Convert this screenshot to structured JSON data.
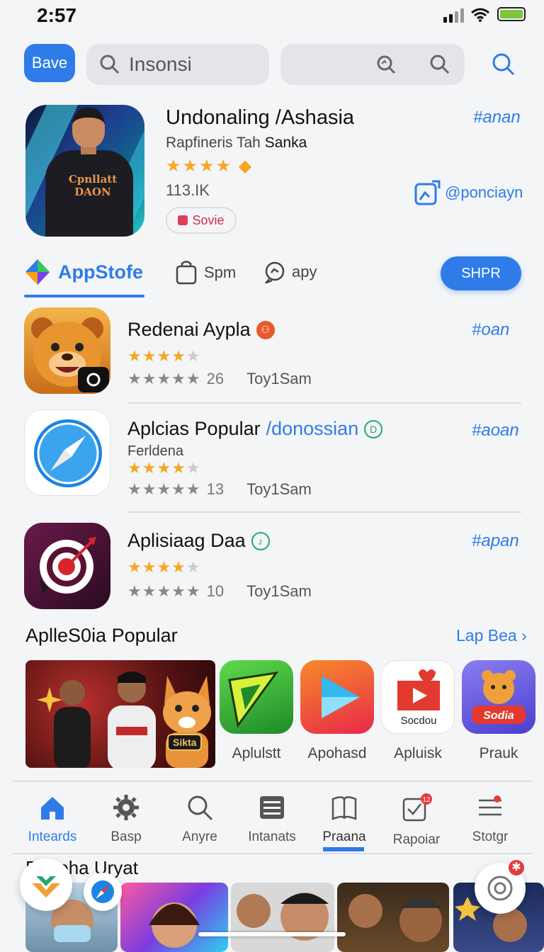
{
  "status": {
    "time": "2:57"
  },
  "header": {
    "save_label": "Bave",
    "search_text": "Insonsi"
  },
  "featured": {
    "title": "Undonaling /Ashasia",
    "subtitle_a": "Rapfineris Tah",
    "subtitle_b": "Sanka",
    "stars": "★★★★",
    "count": "113.IK",
    "badge": "Sovie",
    "tag": "#anan",
    "link": "@ponciayn",
    "shirt_text": "Cpnllatt DAON"
  },
  "tabs": {
    "store": "AppStofe",
    "tab2": "Spm",
    "tab3": "apy",
    "button": "SHPR"
  },
  "apps": [
    {
      "name": "Redenai Aypla",
      "tag": "#oan",
      "count": "26",
      "publisher": "Toy1Sam"
    },
    {
      "name": "Aplcias Popular",
      "name_suffix": "/donossian",
      "developer": "Ferldena",
      "tag": "#aoan",
      "count": "13",
      "publisher": "Toy1Sam"
    },
    {
      "name": "Aplisiaag Daa",
      "tag": "#apan",
      "count": "10",
      "publisher": "Toy1Sam"
    }
  ],
  "stars_glyph": "★★★★",
  "grey_stars": "★★★★★",
  "popular": {
    "title": "AplleS0ia Popular",
    "more": "Lap Bea ›",
    "banner_tag": "Sikta",
    "apps": [
      {
        "label": "Aplulstt"
      },
      {
        "label": "Apohasd"
      },
      {
        "label": "Apluisk",
        "icon_text": "Socdou"
      },
      {
        "label": "Prauk",
        "icon_text": "Sodia"
      }
    ]
  },
  "nav": [
    {
      "label": "Inteards"
    },
    {
      "label": "Basp"
    },
    {
      "label": "Anyre"
    },
    {
      "label": "Intanats"
    },
    {
      "label": "Praana"
    },
    {
      "label": "Rapoiar"
    },
    {
      "label": "Stotgr"
    }
  ],
  "trending": {
    "title": "Panoha Uryat"
  }
}
